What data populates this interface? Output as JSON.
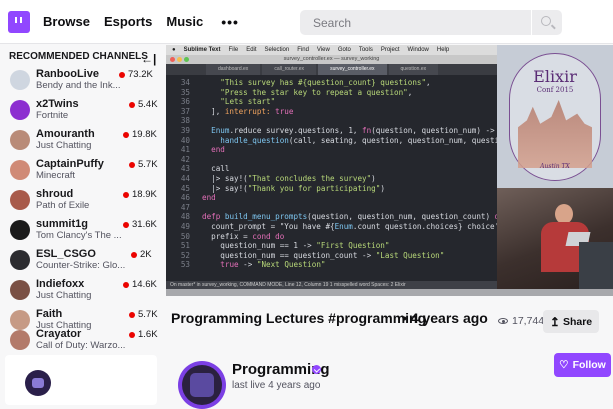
{
  "nav": {
    "links": [
      "Browse",
      "Esports",
      "Music"
    ],
    "more": "•••",
    "search_placeholder": "Search"
  },
  "sidebar": {
    "heading": "RECOMMENDED CHANNELS",
    "collapse_glyph": "←|",
    "channels": [
      {
        "name": "RanbooLive",
        "game": "Bendy and the Ink...",
        "viewers": "73.2K",
        "color": "#cfd6e0"
      },
      {
        "name": "x2Twins",
        "game": "Fortnite",
        "viewers": "5.4K",
        "color": "#8c2ed0"
      },
      {
        "name": "Amouranth",
        "game": "Just Chatting",
        "viewers": "19.8K",
        "color": "#b98b78"
      },
      {
        "name": "CaptainPuffy",
        "game": "Minecraft",
        "viewers": "5.7K",
        "color": "#d08a76"
      },
      {
        "name": "shroud",
        "game": "Path of Exile",
        "viewers": "18.9K",
        "color": "#a85a4a"
      },
      {
        "name": "summit1g",
        "game": "Tom Clancy's The ...",
        "viewers": "31.6K",
        "color": "#1b1b1b"
      },
      {
        "name": "ESL_CSGO",
        "game": "Counter-Strike: Glo...",
        "viewers": "2K",
        "color": "#2c2c30"
      },
      {
        "name": "Indiefoxx",
        "game": "Just Chatting",
        "viewers": "14.6K",
        "color": "#7a5044"
      },
      {
        "name": "Faith",
        "game": "Just Chatting",
        "viewers": "5.7K",
        "color": "#c69a85"
      },
      {
        "name": "Crayator",
        "game": "Call of Duty: Warzo...",
        "viewers": "1.6K",
        "color": "#b37a6a"
      }
    ]
  },
  "video": {
    "mac_menu": [
      "Sublime Text",
      "File",
      "Edit",
      "Selection",
      "Find",
      "View",
      "Goto",
      "Tools",
      "Project",
      "Window",
      "Help"
    ],
    "window_title": "survey_controller.ex — survey_working",
    "tabs": [
      "dashboard.ex",
      "call_router.ex",
      "survey_controller.ex",
      "question.ex"
    ],
    "code_lines": [
      {
        "n": "34",
        "t": "    \"This survey has #{question_count} questions\","
      },
      {
        "n": "35",
        "t": "    \"Press the star key to repeat a question\","
      },
      {
        "n": "36",
        "t": "    \"Lets start\""
      },
      {
        "n": "37",
        "t": "  ], interrupt: true"
      },
      {
        "n": "38",
        "t": ""
      },
      {
        "n": "39",
        "t": "  Enum.reduce survey.questions, 1, fn(question, question_num) ->"
      },
      {
        "n": "40",
        "t": "    handle_question(call, seating, question, question_num, questi"
      },
      {
        "n": "41",
        "t": "  end"
      },
      {
        "n": "42",
        "t": ""
      },
      {
        "n": "43",
        "t": "  call"
      },
      {
        "n": "44",
        "t": "  |> say!(\"That concludes the survey\")"
      },
      {
        "n": "45",
        "t": "  |> say!(\"Thank you for participating\")"
      },
      {
        "n": "46",
        "t": "end"
      },
      {
        "n": "47",
        "t": ""
      },
      {
        "n": "48",
        "t": "defp build_menu_prompts(question, question_num, question_count) do"
      },
      {
        "n": "49",
        "t": "  count_prompt = \"You have #{Enum.count question.choices} choice'"
      },
      {
        "n": "50",
        "t": "  prefix = cond do"
      },
      {
        "n": "51",
        "t": "    question_num == 1 -> \"First Question\""
      },
      {
        "n": "52",
        "t": "    question_num == question_count -> \"Last Question\""
      },
      {
        "n": "53",
        "t": "    true -> \"Next Question\""
      }
    ],
    "status_bar": "On master* in survey_working, COMMAND MODE, Line 12, Column 19          1 misspelled word     Spaces: 2     Elixir",
    "poster_title": "Elixir",
    "poster_sub": "Conf 2015",
    "poster_city": "Austin TX"
  },
  "stream": {
    "title": "Programming Lectures #programming",
    "separator_ago": "• 4 years ago",
    "views": "17,744",
    "share_label": "Share",
    "share_icon": "share-icon"
  },
  "channel": {
    "name": "Programming",
    "last_live": "last live 4 years ago",
    "follow_label": "Follow",
    "follow_icon": "♡"
  },
  "colors": {
    "accent": "#9147ff",
    "live": "#eb0400"
  }
}
